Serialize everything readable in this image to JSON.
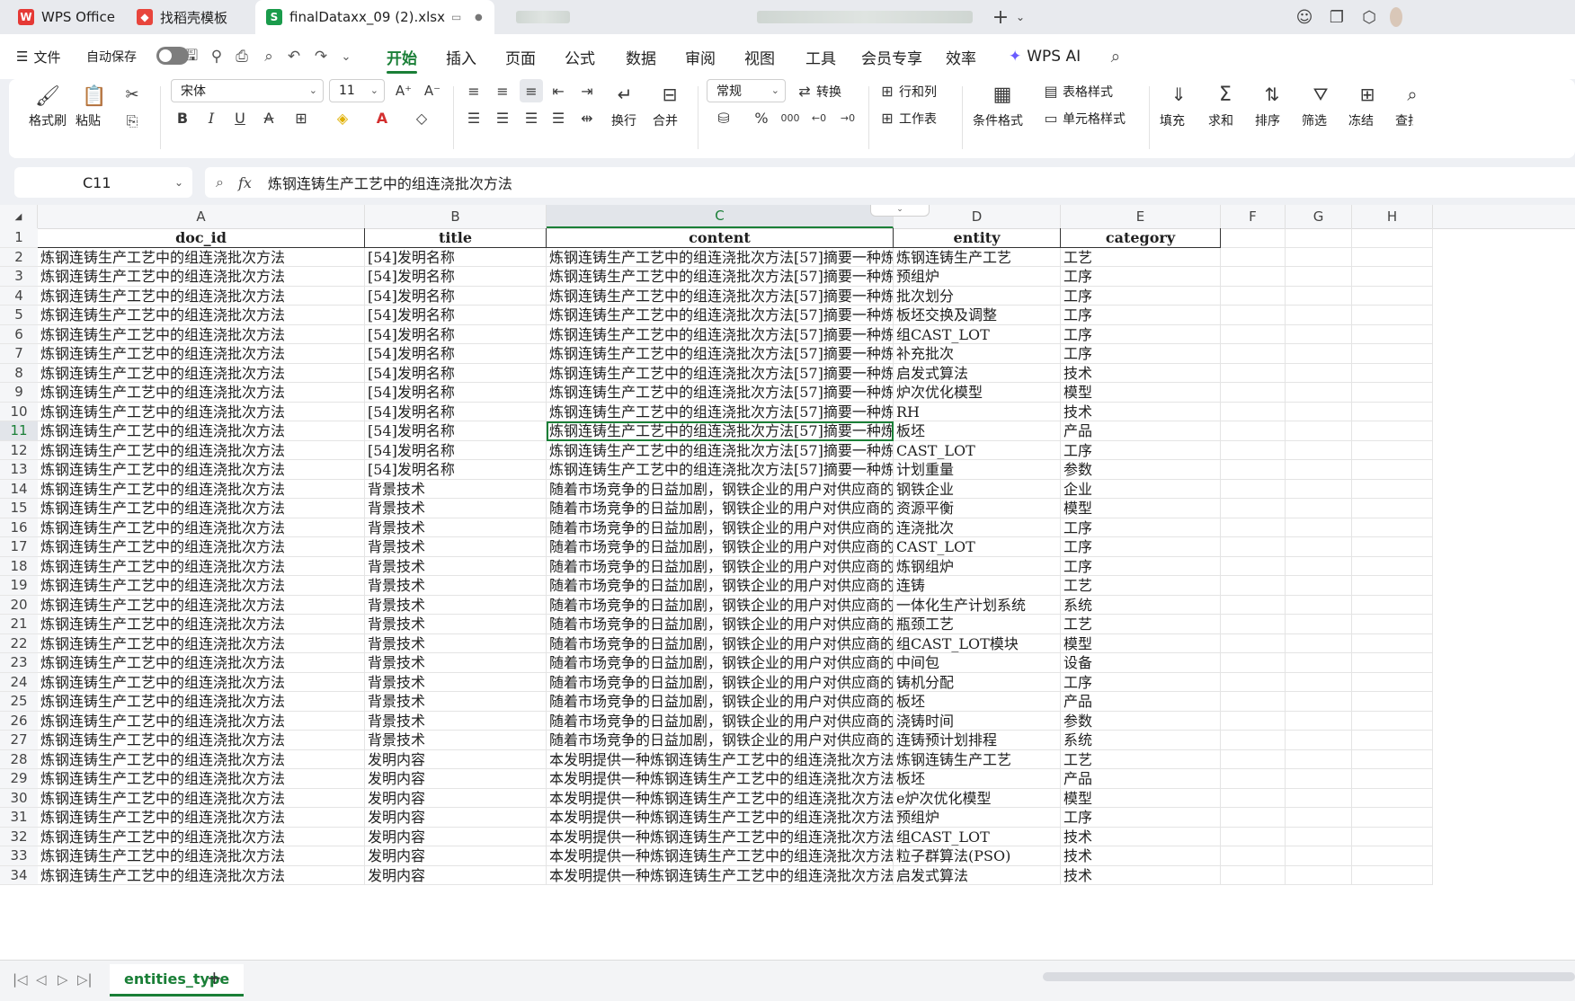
{
  "tabs": [
    {
      "label": "WPS Office",
      "icon": "wps-logo-icon",
      "color": "#e53935"
    },
    {
      "label": "找稻壳模板",
      "icon": "docer-icon",
      "color": "#e8453c"
    },
    {
      "label": "finalDataxx_09 (2).xlsx",
      "icon": "spreadsheet-icon",
      "color": "#1a9b4b",
      "active": true
    }
  ],
  "menu": {
    "file_label": "文件",
    "autosave_label": "自动保存",
    "items": [
      "开始",
      "插入",
      "页面",
      "公式",
      "数据",
      "审阅",
      "视图",
      "工具",
      "会员专享",
      "效率"
    ],
    "active": "开始",
    "ai_label": "WPS AI"
  },
  "ribbon": {
    "format_painter": "格式刷",
    "paste": "粘贴",
    "font_name": "宋体",
    "font_size": "11",
    "wrap": "换行",
    "merge": "合并",
    "number_format": "常规",
    "convert": "转换",
    "rows_cols": "行和列",
    "worksheet": "工作表",
    "conditional_format": "条件格式",
    "table_style": "表格样式",
    "cell_style": "单元格样式",
    "fill": "填充",
    "sum": "求和",
    "sort": "排序",
    "filter": "筛选",
    "freeze": "冻结",
    "find": "查找",
    "percent": "%",
    "thousands": "000"
  },
  "formula": {
    "cell_ref": "C11",
    "fx": "fx",
    "value": "炼钢连铸生产工艺中的组连浇批次方法"
  },
  "columns": [
    "A",
    "B",
    "C",
    "D",
    "E",
    "F",
    "G",
    "H"
  ],
  "selected_column": "C",
  "selected_row": 11,
  "headers": [
    "doc_id",
    "title",
    "content",
    "entity",
    "category"
  ],
  "rows": [
    [
      "炼钢连铸生产工艺中的组连浇批次方法",
      "[54]发明名称",
      "炼钢连铸生产工艺中的组连浇批次方法[57]摘要一种炼",
      "炼钢连铸生产工艺",
      "工艺"
    ],
    [
      "炼钢连铸生产工艺中的组连浇批次方法",
      "[54]发明名称",
      "炼钢连铸生产工艺中的组连浇批次方法[57]摘要一种炼",
      "预组炉",
      "工序"
    ],
    [
      "炼钢连铸生产工艺中的组连浇批次方法",
      "[54]发明名称",
      "炼钢连铸生产工艺中的组连浇批次方法[57]摘要一种炼",
      "批次划分",
      "工序"
    ],
    [
      "炼钢连铸生产工艺中的组连浇批次方法",
      "[54]发明名称",
      "炼钢连铸生产工艺中的组连浇批次方法[57]摘要一种炼",
      "板坯交换及调整",
      "工序"
    ],
    [
      "炼钢连铸生产工艺中的组连浇批次方法",
      "[54]发明名称",
      "炼钢连铸生产工艺中的组连浇批次方法[57]摘要一种炼",
      "组CAST_LOT",
      "工序"
    ],
    [
      "炼钢连铸生产工艺中的组连浇批次方法",
      "[54]发明名称",
      "炼钢连铸生产工艺中的组连浇批次方法[57]摘要一种炼",
      "补充批次",
      "工序"
    ],
    [
      "炼钢连铸生产工艺中的组连浇批次方法",
      "[54]发明名称",
      "炼钢连铸生产工艺中的组连浇批次方法[57]摘要一种炼",
      "启发式算法",
      "技术"
    ],
    [
      "炼钢连铸生产工艺中的组连浇批次方法",
      "[54]发明名称",
      "炼钢连铸生产工艺中的组连浇批次方法[57]摘要一种炼",
      "炉次优化模型",
      "模型"
    ],
    [
      "炼钢连铸生产工艺中的组连浇批次方法",
      "[54]发明名称",
      "炼钢连铸生产工艺中的组连浇批次方法[57]摘要一种炼",
      "RH",
      "技术"
    ],
    [
      "炼钢连铸生产工艺中的组连浇批次方法",
      "[54]发明名称",
      "炼钢连铸生产工艺中的组连浇批次方法[57]摘要一种炼",
      "板坯",
      "产品"
    ],
    [
      "炼钢连铸生产工艺中的组连浇批次方法",
      "[54]发明名称",
      "炼钢连铸生产工艺中的组连浇批次方法[57]摘要一种炼",
      "CAST_LOT",
      "工序"
    ],
    [
      "炼钢连铸生产工艺中的组连浇批次方法",
      "[54]发明名称",
      "炼钢连铸生产工艺中的组连浇批次方法[57]摘要一种炼",
      "计划重量",
      "参数"
    ],
    [
      "炼钢连铸生产工艺中的组连浇批次方法",
      "背景技术",
      "随着市场竞争的日益加剧，钢铁企业的用户对供应商的",
      "钢铁企业",
      "企业"
    ],
    [
      "炼钢连铸生产工艺中的组连浇批次方法",
      "背景技术",
      "随着市场竞争的日益加剧，钢铁企业的用户对供应商的",
      "资源平衡",
      "模型"
    ],
    [
      "炼钢连铸生产工艺中的组连浇批次方法",
      "背景技术",
      "随着市场竞争的日益加剧，钢铁企业的用户对供应商的",
      "连浇批次",
      "工序"
    ],
    [
      "炼钢连铸生产工艺中的组连浇批次方法",
      "背景技术",
      "随着市场竞争的日益加剧，钢铁企业的用户对供应商的",
      "CAST_LOT",
      "工序"
    ],
    [
      "炼钢连铸生产工艺中的组连浇批次方法",
      "背景技术",
      "随着市场竞争的日益加剧，钢铁企业的用户对供应商的",
      "炼钢组炉",
      "工序"
    ],
    [
      "炼钢连铸生产工艺中的组连浇批次方法",
      "背景技术",
      "随着市场竞争的日益加剧，钢铁企业的用户对供应商的",
      "连铸",
      "工艺"
    ],
    [
      "炼钢连铸生产工艺中的组连浇批次方法",
      "背景技术",
      "随着市场竞争的日益加剧，钢铁企业的用户对供应商的",
      "一体化生产计划系统",
      "系统"
    ],
    [
      "炼钢连铸生产工艺中的组连浇批次方法",
      "背景技术",
      "随着市场竞争的日益加剧，钢铁企业的用户对供应商的",
      "瓶颈工艺",
      "工艺"
    ],
    [
      "炼钢连铸生产工艺中的组连浇批次方法",
      "背景技术",
      "随着市场竞争的日益加剧，钢铁企业的用户对供应商的",
      "组CAST_LOT模块",
      "模型"
    ],
    [
      "炼钢连铸生产工艺中的组连浇批次方法",
      "背景技术",
      "随着市场竞争的日益加剧，钢铁企业的用户对供应商的",
      "中间包",
      "设备"
    ],
    [
      "炼钢连铸生产工艺中的组连浇批次方法",
      "背景技术",
      "随着市场竞争的日益加剧，钢铁企业的用户对供应商的",
      "铸机分配",
      "工序"
    ],
    [
      "炼钢连铸生产工艺中的组连浇批次方法",
      "背景技术",
      "随着市场竞争的日益加剧，钢铁企业的用户对供应商的",
      "板坯",
      "产品"
    ],
    [
      "炼钢连铸生产工艺中的组连浇批次方法",
      "背景技术",
      "随着市场竞争的日益加剧，钢铁企业的用户对供应商的",
      "浇铸时间",
      "参数"
    ],
    [
      "炼钢连铸生产工艺中的组连浇批次方法",
      "背景技术",
      "随着市场竞争的日益加剧，钢铁企业的用户对供应商的",
      "连铸预计划排程",
      "系统"
    ],
    [
      "炼钢连铸生产工艺中的组连浇批次方法",
      "发明内容",
      "本发明提供一种炼钢连铸生产工艺中的组连浇批次方法",
      "炼钢连铸生产工艺",
      "工艺"
    ],
    [
      "炼钢连铸生产工艺中的组连浇批次方法",
      "发明内容",
      "本发明提供一种炼钢连铸生产工艺中的组连浇批次方法",
      "板坯",
      "产品"
    ],
    [
      "炼钢连铸生产工艺中的组连浇批次方法",
      "发明内容",
      "本发明提供一种炼钢连铸生产工艺中的组连浇批次方法",
      "e炉次优化模型",
      "模型"
    ],
    [
      "炼钢连铸生产工艺中的组连浇批次方法",
      "发明内容",
      "本发明提供一种炼钢连铸生产工艺中的组连浇批次方法",
      "预组炉",
      "工序"
    ],
    [
      "炼钢连铸生产工艺中的组连浇批次方法",
      "发明内容",
      "本发明提供一种炼钢连铸生产工艺中的组连浇批次方法",
      "组CAST_LOT",
      "技术"
    ],
    [
      "炼钢连铸生产工艺中的组连浇批次方法",
      "发明内容",
      "本发明提供一种炼钢连铸生产工艺中的组连浇批次方法",
      "粒子群算法(PSO)",
      "技术"
    ],
    [
      "炼钢连铸生产工艺中的组连浇批次方法",
      "发明内容",
      "本发明提供一种炼钢连铸生产工艺中的组连浇批次方法",
      "启发式算法",
      "技术"
    ]
  ],
  "sheet_tab": "entities_type",
  "accent": "#1a7f37"
}
